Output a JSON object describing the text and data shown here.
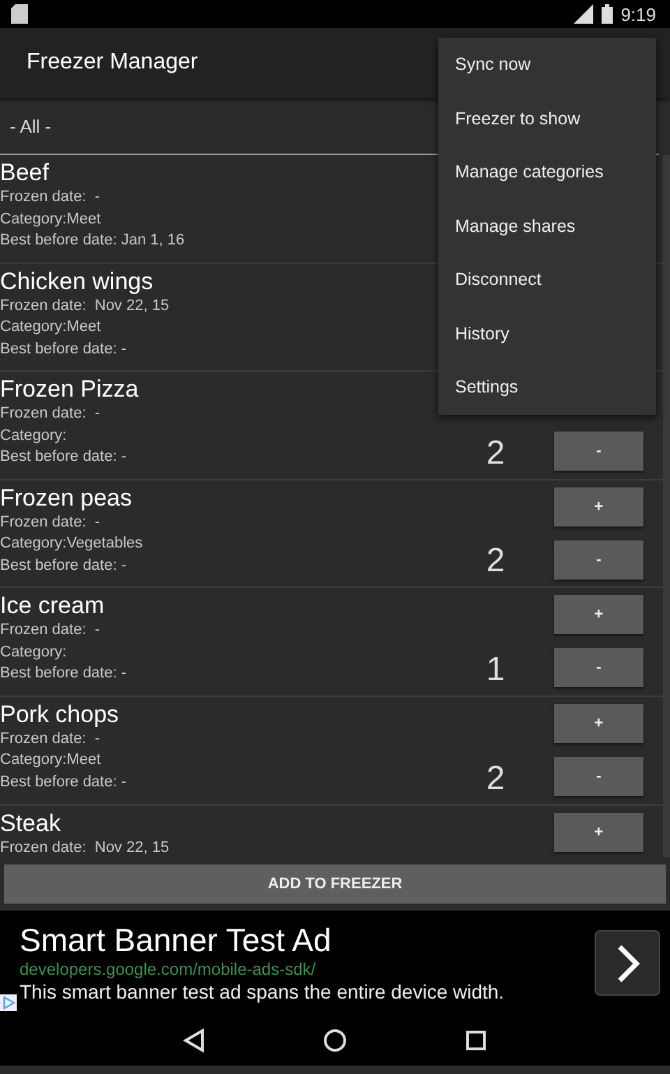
{
  "status_bar": {
    "time": "9:19"
  },
  "app_bar": {
    "title": "Freezer Manager"
  },
  "filter": {
    "value": "- All -"
  },
  "items": [
    {
      "name": "Beef",
      "details": [
        "Frozen date:  -",
        "Category:Meet",
        "Best before date: Jan 1, 16"
      ]
    },
    {
      "name": "Chicken wings",
      "details": [
        "Frozen date:  Nov 22, 15",
        "Category:Meet",
        "Best before date: -"
      ]
    },
    {
      "name": "Frozen Pizza",
      "details": [
        "Frozen date:  -",
        "Category:",
        "Best before date: -"
      ],
      "count": "2",
      "minus": "-"
    },
    {
      "name": "Frozen peas",
      "details": [
        "Frozen date:  -",
        "Category:Vegetables",
        "Best before date: -"
      ],
      "count": "2",
      "plus": "+",
      "minus": "-"
    },
    {
      "name": "Ice cream",
      "details": [
        "Frozen date:  -",
        "Category:",
        "Best before date: -"
      ],
      "count": "1",
      "plus": "+",
      "minus": "-"
    },
    {
      "name": "Pork chops",
      "details": [
        "Frozen date:  -",
        "Category:Meet",
        "Best before date: -"
      ],
      "count": "2",
      "plus": "+",
      "minus": "-"
    },
    {
      "name": "Steak",
      "details": [
        "Frozen date:  Nov 22, 15"
      ],
      "plus": "+"
    }
  ],
  "add_button": "ADD TO FREEZER",
  "ad": {
    "title": "Smart Banner Test Ad",
    "url": "developers.google.com/mobile-ads-sdk/",
    "text": "This smart banner test ad spans the entire device width."
  },
  "menu": [
    "Sync now",
    "Freezer to show",
    "Manage categories",
    "Manage shares",
    "Disconnect",
    "History",
    "Settings"
  ]
}
